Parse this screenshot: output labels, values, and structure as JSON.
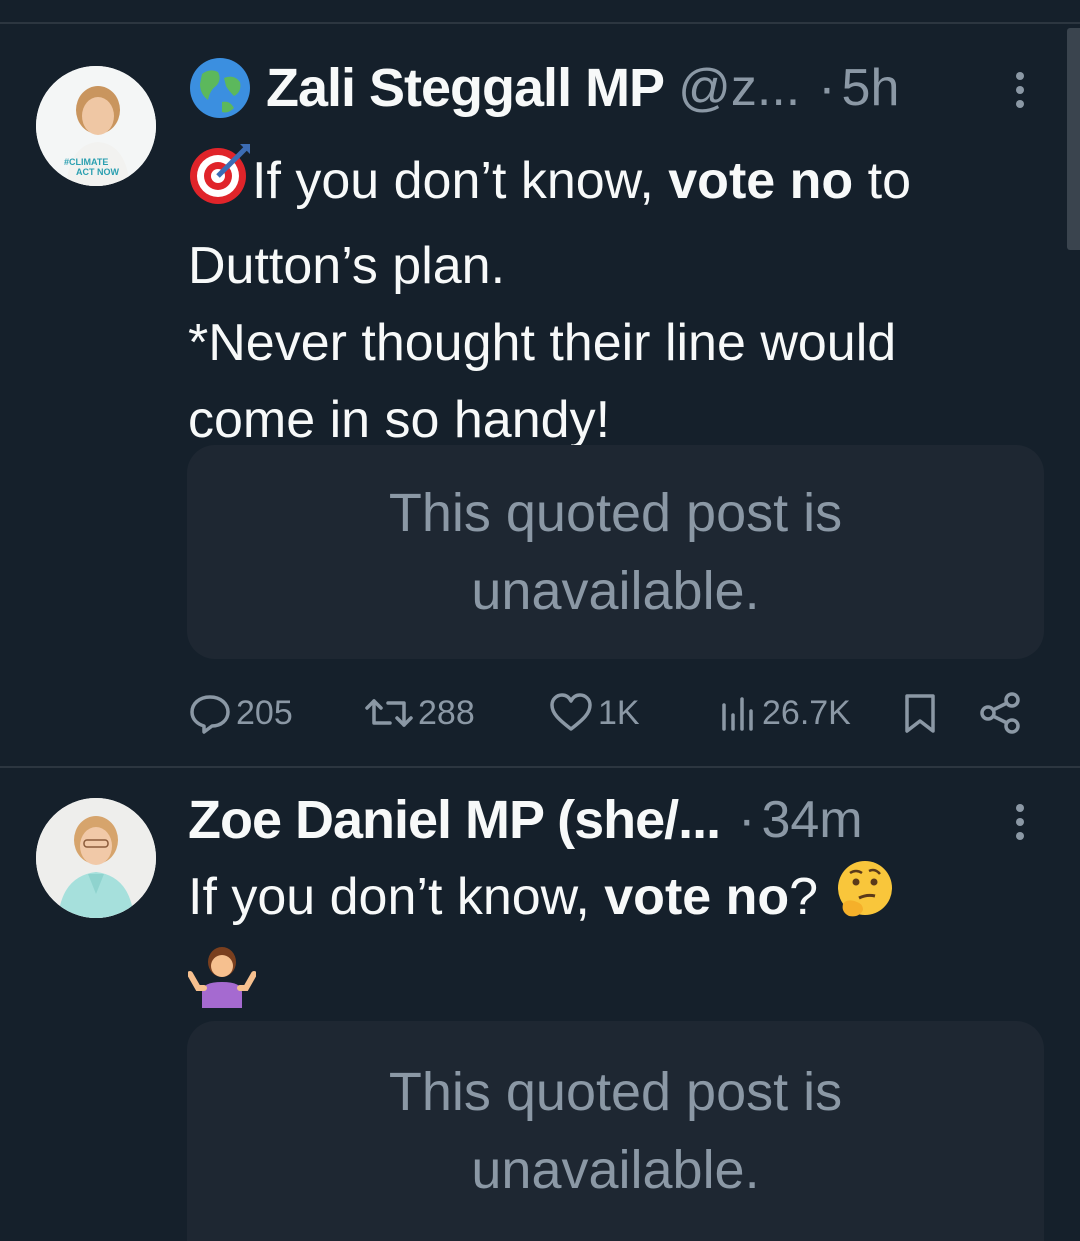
{
  "tweets": [
    {
      "avatar_badge": "#CLIMATE ACT NOW",
      "name_prefix_icon": "globe-icon",
      "display_name": "Zali Steggall MP",
      "handle": "@z...",
      "separator": "·",
      "time": "5h",
      "body": {
        "lead_icon": "direct-hit-target-icon",
        "line1_a": "If you don’t know, ",
        "line1_bold": "vote no",
        "line1_b": " to",
        "line2": "Dutton’s plan.",
        "line3": "*Never thought their line would",
        "line4": "come in so handy!"
      },
      "quoted": "This quoted post is unavailable.",
      "stats": {
        "replies": "205",
        "reposts": "288",
        "likes": "1K",
        "views": "26.7K"
      }
    },
    {
      "display_name": "Zoe Daniel MP (she/...",
      "separator": "·",
      "time": "34m",
      "body": {
        "line1_a": "If you don’t know, ",
        "line1_bold": "vote no",
        "line1_b": "?",
        "emoji_1": "thinking-face-icon",
        "emoji_2": "person-shrugging-icon"
      },
      "quoted": "This quoted post is unavailable."
    }
  ],
  "colors": {
    "background": "#15202b",
    "card": "#1e2732",
    "text": "#f7f9f9",
    "muted": "#8b98a5",
    "divider": "#2c3640"
  }
}
